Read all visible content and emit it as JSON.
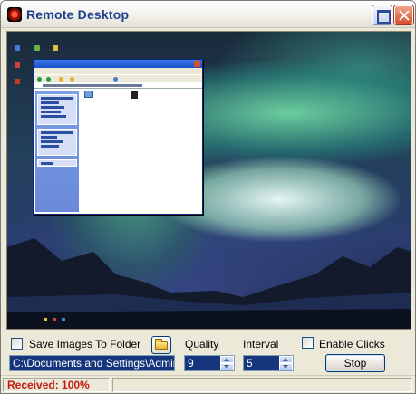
{
  "window": {
    "title": "Remote Desktop",
    "accent": "#1d3f8f"
  },
  "icons": {
    "app": "remote-desktop-icon",
    "maximize": "maximize-icon",
    "close": "close-icon",
    "folder": "folder-open-icon",
    "spin_up": "arrow-up-icon",
    "spin_down": "arrow-down-icon"
  },
  "controls": {
    "save_images_label": "Save Images To Folder",
    "save_images_checked": false,
    "quality_label": "Quality",
    "interval_label": "Interval",
    "enable_clicks_label": "Enable Clicks",
    "enable_clicks_checked": false,
    "folder_path": "C:\\Documents and Settings\\Administ",
    "quality_value": "9",
    "interval_value": "5",
    "stop_label": "Stop"
  },
  "status": {
    "text": "Received: 100%",
    "color": "#c01a12"
  }
}
